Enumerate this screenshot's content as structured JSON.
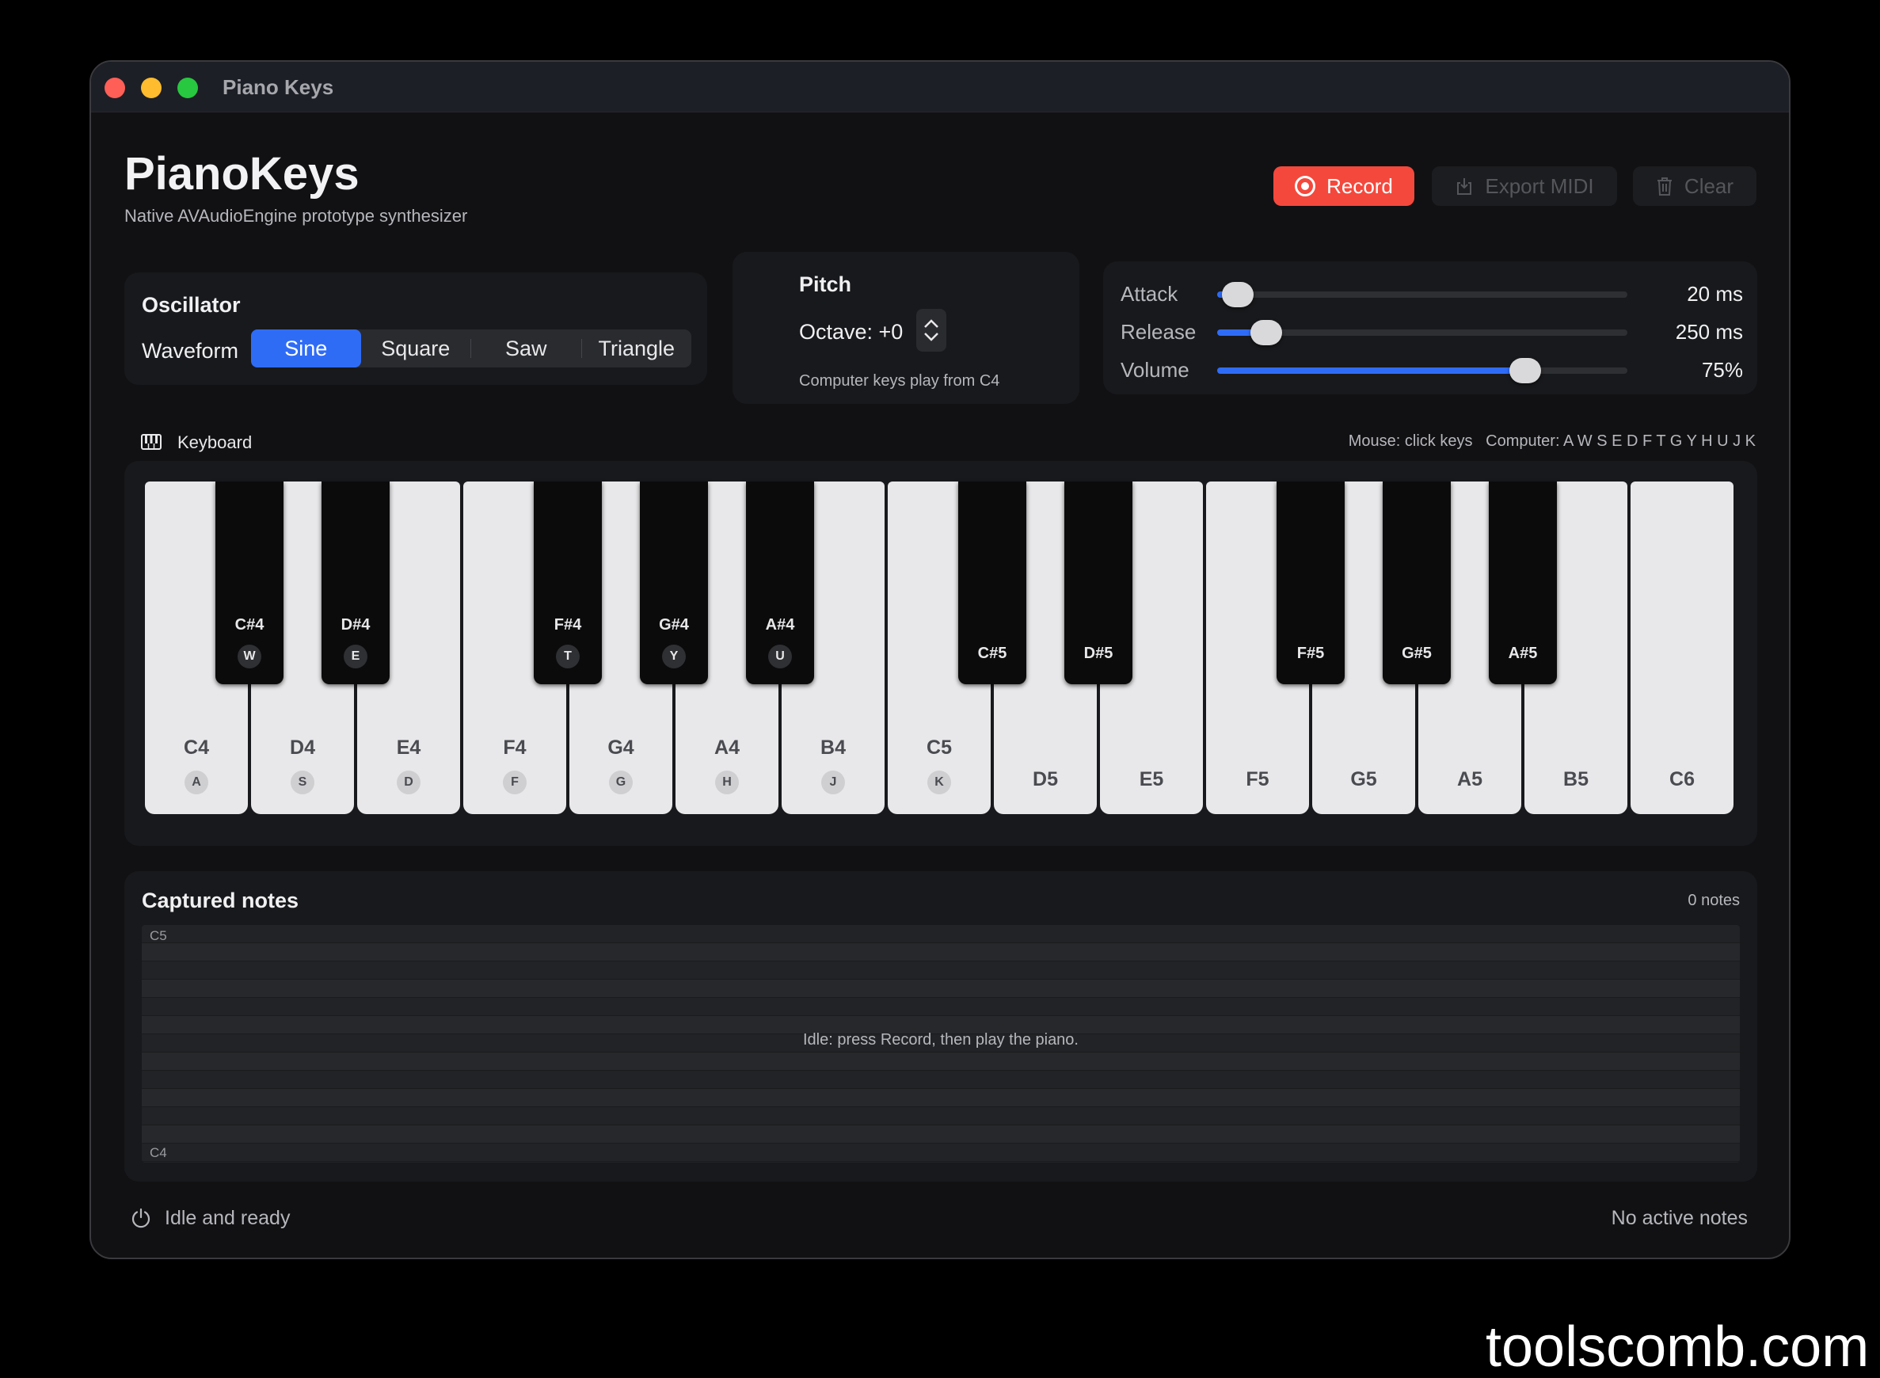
{
  "window": {
    "title": "Piano Keys"
  },
  "header": {
    "title": "PianoKeys",
    "subtitle": "Native AVAudioEngine prototype synthesizer",
    "record_label": "Record",
    "export_label": "Export MIDI",
    "clear_label": "Clear"
  },
  "oscillator": {
    "title": "Oscillator",
    "waveform_label": "Waveform",
    "options": [
      "Sine",
      "Square",
      "Saw",
      "Triangle"
    ],
    "selected": "Sine"
  },
  "pitch": {
    "title": "Pitch",
    "octave_label": "Octave: +0",
    "note": "Computer keys play from C4"
  },
  "envelope": {
    "attack": {
      "label": "Attack",
      "value": "20 ms",
      "level": 0.05
    },
    "release": {
      "label": "Release",
      "value": "250 ms",
      "level": 0.12
    },
    "volume": {
      "label": "Volume",
      "value": "75%",
      "level": 0.75
    }
  },
  "keyboard": {
    "title": "Keyboard",
    "hint": "Mouse: click keys   Computer: A W S E D F T G Y H U J K",
    "white_keys": [
      {
        "note": "C4",
        "key": "A"
      },
      {
        "note": "D4",
        "key": "S"
      },
      {
        "note": "E4",
        "key": "D"
      },
      {
        "note": "F4",
        "key": "F"
      },
      {
        "note": "G4",
        "key": "G"
      },
      {
        "note": "A4",
        "key": "H"
      },
      {
        "note": "B4",
        "key": "J"
      },
      {
        "note": "C5",
        "key": "K"
      },
      {
        "note": "D5",
        "key": ""
      },
      {
        "note": "E5",
        "key": ""
      },
      {
        "note": "F5",
        "key": ""
      },
      {
        "note": "G5",
        "key": ""
      },
      {
        "note": "A5",
        "key": ""
      },
      {
        "note": "B5",
        "key": ""
      },
      {
        "note": "C6",
        "key": ""
      }
    ],
    "black_keys": [
      {
        "note": "C#4",
        "key": "W"
      },
      {
        "note": "D#4",
        "key": "E"
      },
      {
        "note": "F#4",
        "key": "T"
      },
      {
        "note": "G#4",
        "key": "Y"
      },
      {
        "note": "A#4",
        "key": "U"
      },
      {
        "note": "C#5",
        "key": ""
      },
      {
        "note": "D#5",
        "key": ""
      },
      {
        "note": "F#5",
        "key": ""
      },
      {
        "note": "G#5",
        "key": ""
      },
      {
        "note": "A#5",
        "key": ""
      }
    ]
  },
  "captured": {
    "title": "Captured notes",
    "count": "0 notes",
    "top_label": "C5",
    "bottom_label": "C4",
    "message": "Idle: press Record, then play the piano."
  },
  "status": {
    "left": "Idle and ready",
    "right": "No active notes"
  },
  "watermark": "toolscomb.com"
}
